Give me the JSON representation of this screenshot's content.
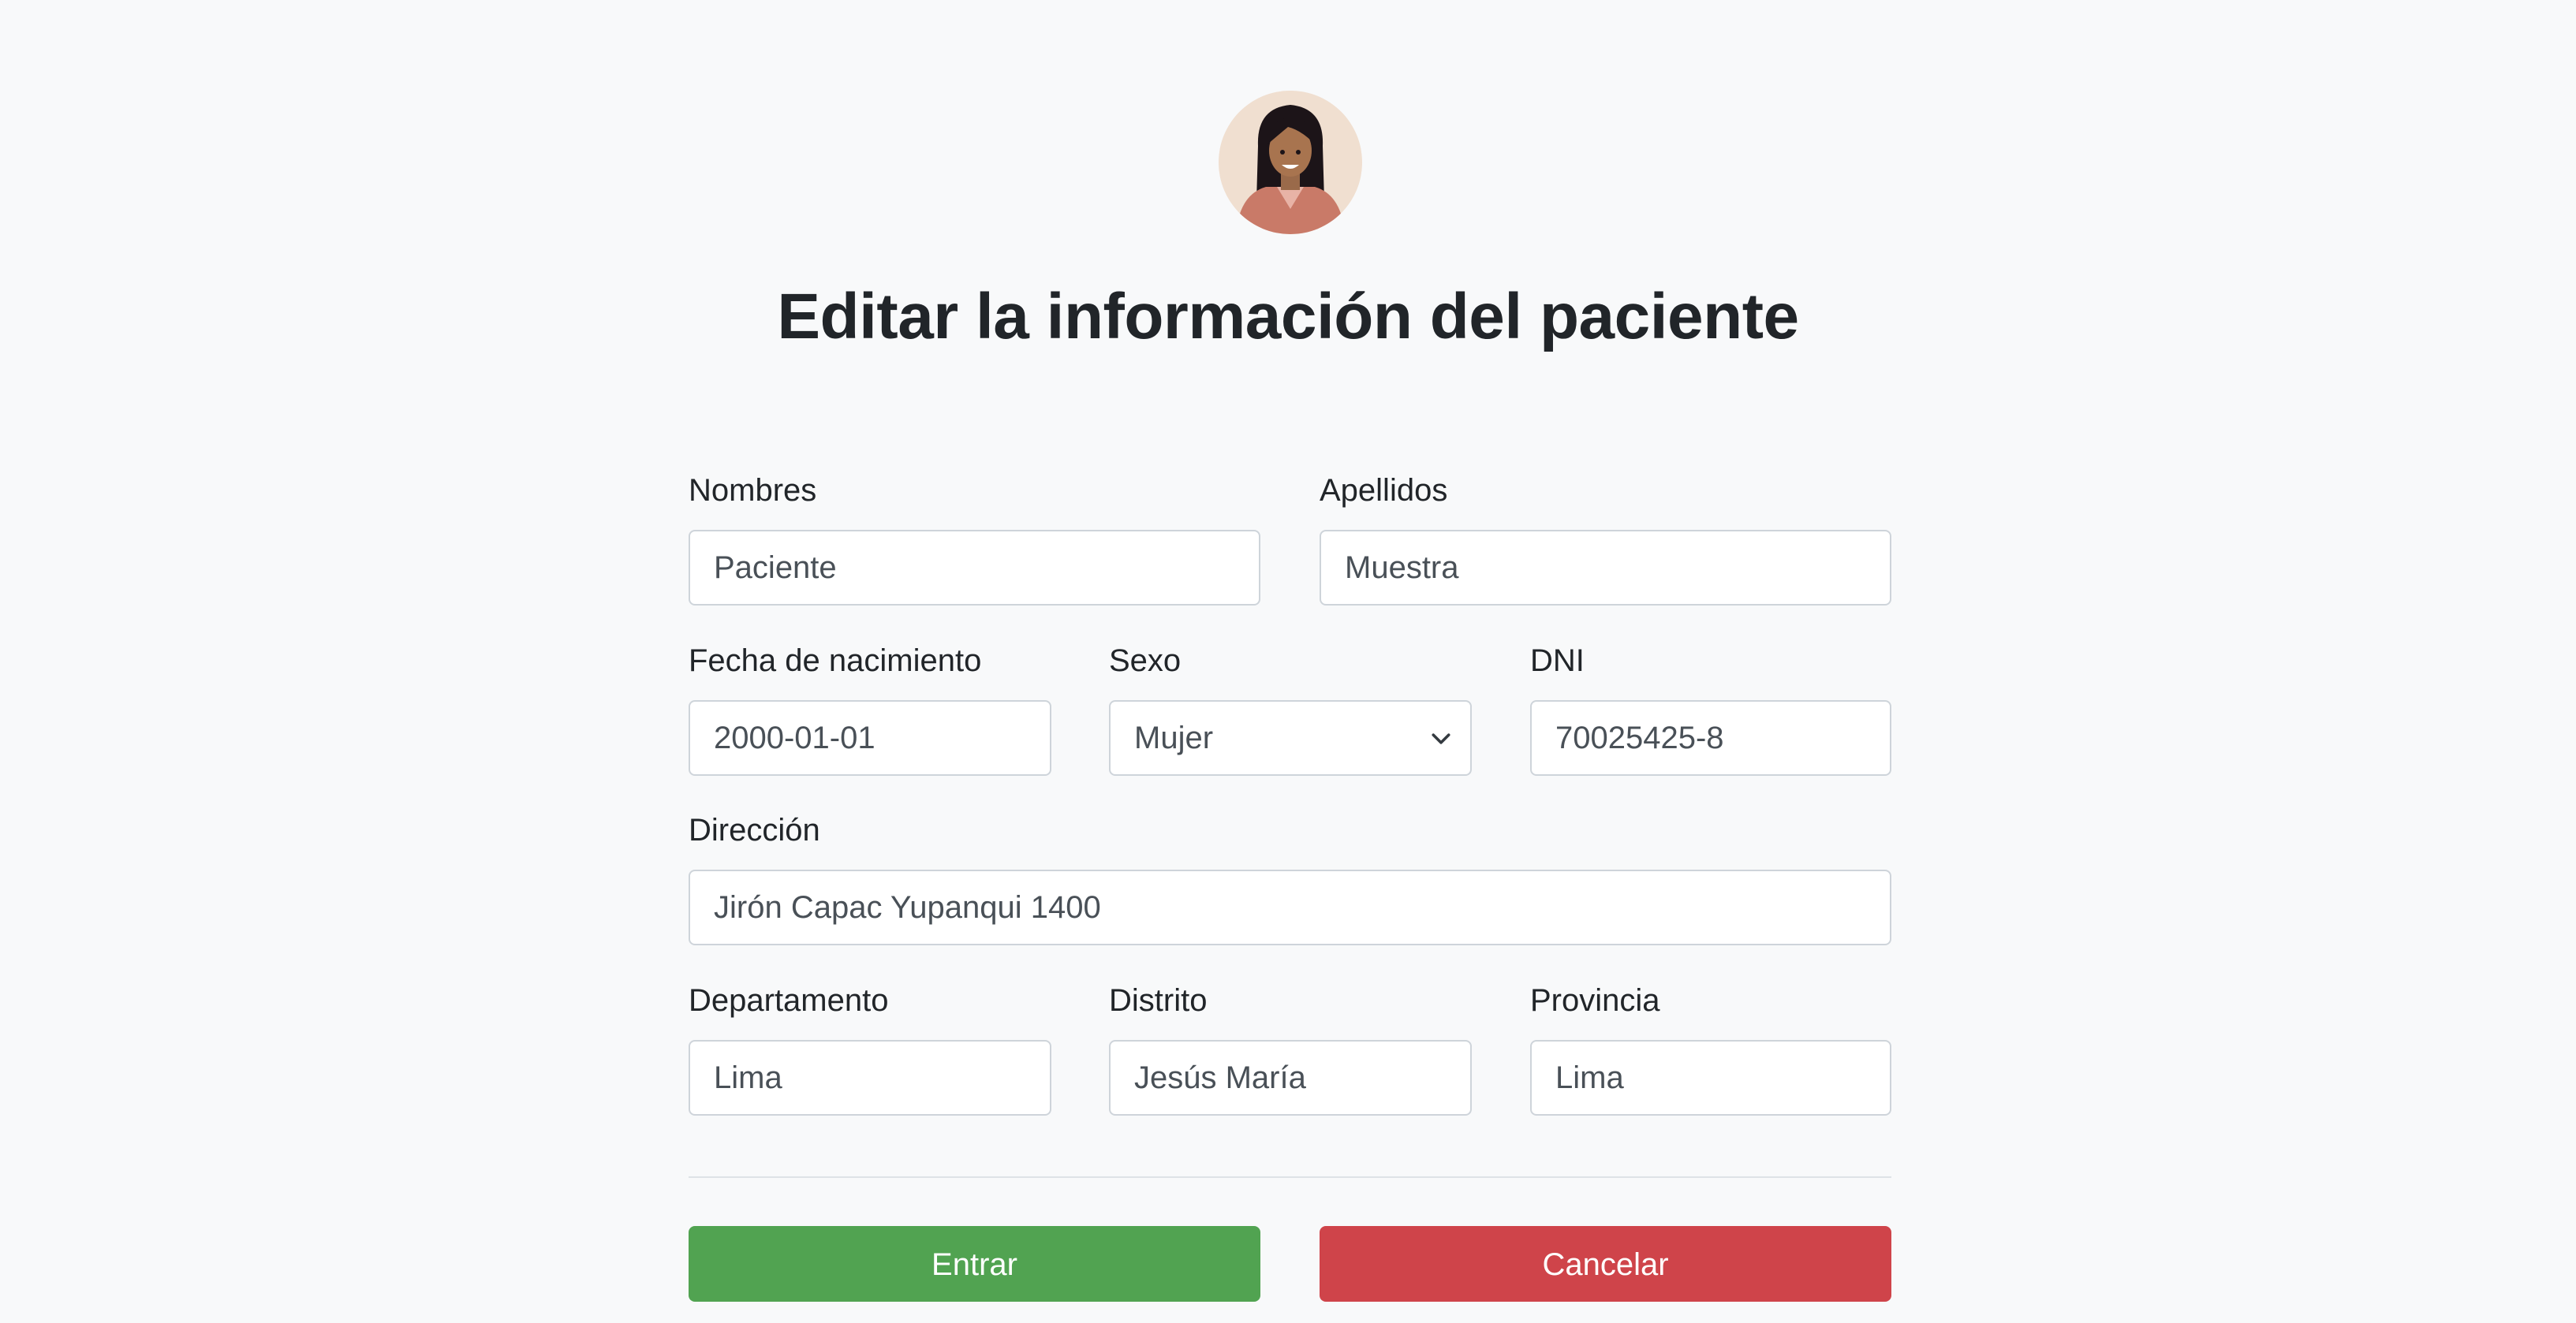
{
  "page": {
    "title": "Editar la información del paciente",
    "avatar_icon": "patient-avatar-woman"
  },
  "form": {
    "nombres": {
      "label": "Nombres",
      "value": "Paciente"
    },
    "apellidos": {
      "label": "Apellidos",
      "value": "Muestra"
    },
    "fecha_nacimiento": {
      "label": "Fecha de nacimiento",
      "value": "2000-01-01"
    },
    "sexo": {
      "label": "Sexo",
      "value": "Mujer",
      "icon": "chevron-down-icon"
    },
    "dni": {
      "label": "DNI",
      "value": "70025425-8"
    },
    "direccion": {
      "label": "Dirección",
      "value": "Jirón Capac Yupanqui 1400"
    },
    "departamento": {
      "label": "Departamento",
      "value": "Lima"
    },
    "distrito": {
      "label": "Distrito",
      "value": "Jesús María"
    },
    "provincia": {
      "label": "Provincia",
      "value": "Lima"
    }
  },
  "actions": {
    "submit_label": "Entrar",
    "cancel_label": "Cancelar"
  },
  "colors": {
    "background": "#f8f9fa",
    "submit": "#51a351",
    "cancel": "#cf444a",
    "border": "#ced4da"
  }
}
